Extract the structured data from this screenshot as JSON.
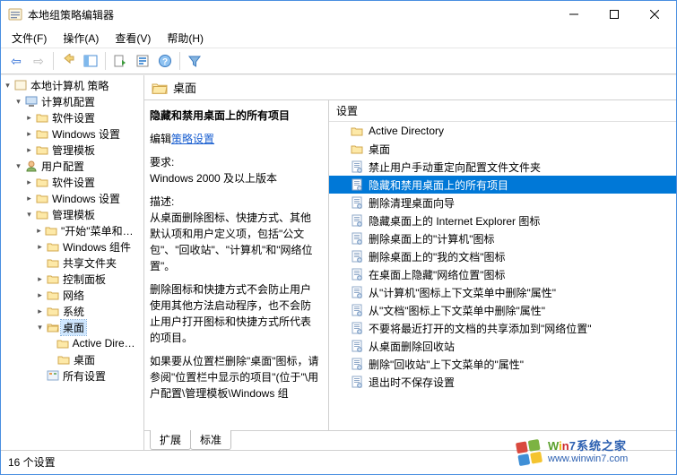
{
  "window": {
    "title": "本地组策略编辑器"
  },
  "menu": {
    "file": "文件(F)",
    "action": "操作(A)",
    "view": "查看(V)",
    "help": "帮助(H)"
  },
  "tree": {
    "root": "本地计算机 策略",
    "computer_cfg": "计算机配置",
    "user_cfg": "用户配置",
    "software": "软件设置",
    "windows": "Windows 设置",
    "admin_tpl": "管理模板",
    "start_menu": "\"开始\"菜单和任务栏",
    "windows_comp": "Windows 组件",
    "shared_folders": "共享文件夹",
    "control_panel": "控制面板",
    "network": "网络",
    "system": "系统",
    "desktop": "桌面",
    "active_dir": "Active Directory",
    "desktop_sub": "桌面",
    "all_settings": "所有设置"
  },
  "header": {
    "title": "桌面"
  },
  "desc": {
    "title": "隐藏和禁用桌面上的所有项目",
    "edit_pre": "编辑",
    "edit_link": "策略设置",
    "req_label": "要求:",
    "req_value": "Windows 2000 及以上版本",
    "desc_label": "描述:",
    "desc_p1": "从桌面删除图标、快捷方式、其他默认项和用户定义项，包括\"公文包\"、\"回收站\"、\"计算机\"和\"网络位置\"。",
    "desc_p2": "删除图标和快捷方式不会防止用户使用其他方法启动程序，也不会防止用户打开图标和快捷方式所代表的项目。",
    "desc_p3": "如果要从位置栏删除\"桌面\"图标，请参阅\"位置栏中显示的项目\"(位于\"\\用户配置\\管理模板\\Windows 组"
  },
  "list": {
    "col": "设置",
    "items": [
      {
        "label": "Active Directory",
        "type": "folder"
      },
      {
        "label": "桌面",
        "type": "folder"
      },
      {
        "label": "禁止用户手动重定向配置文件文件夹",
        "type": "setting"
      },
      {
        "label": "隐藏和禁用桌面上的所有项目",
        "type": "setting",
        "selected": true
      },
      {
        "label": "删除清理桌面向导",
        "type": "setting"
      },
      {
        "label": "隐藏桌面上的 Internet Explorer 图标",
        "type": "setting"
      },
      {
        "label": "删除桌面上的\"计算机\"图标",
        "type": "setting"
      },
      {
        "label": "删除桌面上的\"我的文档\"图标",
        "type": "setting"
      },
      {
        "label": "在桌面上隐藏\"网络位置\"图标",
        "type": "setting"
      },
      {
        "label": "从\"计算机\"图标上下文菜单中删除\"属性\"",
        "type": "setting"
      },
      {
        "label": "从\"文档\"图标上下文菜单中删除\"属性\"",
        "type": "setting"
      },
      {
        "label": "不要将最近打开的文档的共享添加到\"网络位置\"",
        "type": "setting"
      },
      {
        "label": "从桌面删除回收站",
        "type": "setting"
      },
      {
        "label": "删除\"回收站\"上下文菜单的\"属性\"",
        "type": "setting"
      },
      {
        "label": "退出时不保存设置",
        "type": "setting"
      }
    ]
  },
  "tabs": {
    "extended": "扩展",
    "standard": "标准"
  },
  "status": {
    "count": "16 个设置"
  },
  "watermark": {
    "brand": "Win7系统之家",
    "url": "www.winwin7.com"
  }
}
